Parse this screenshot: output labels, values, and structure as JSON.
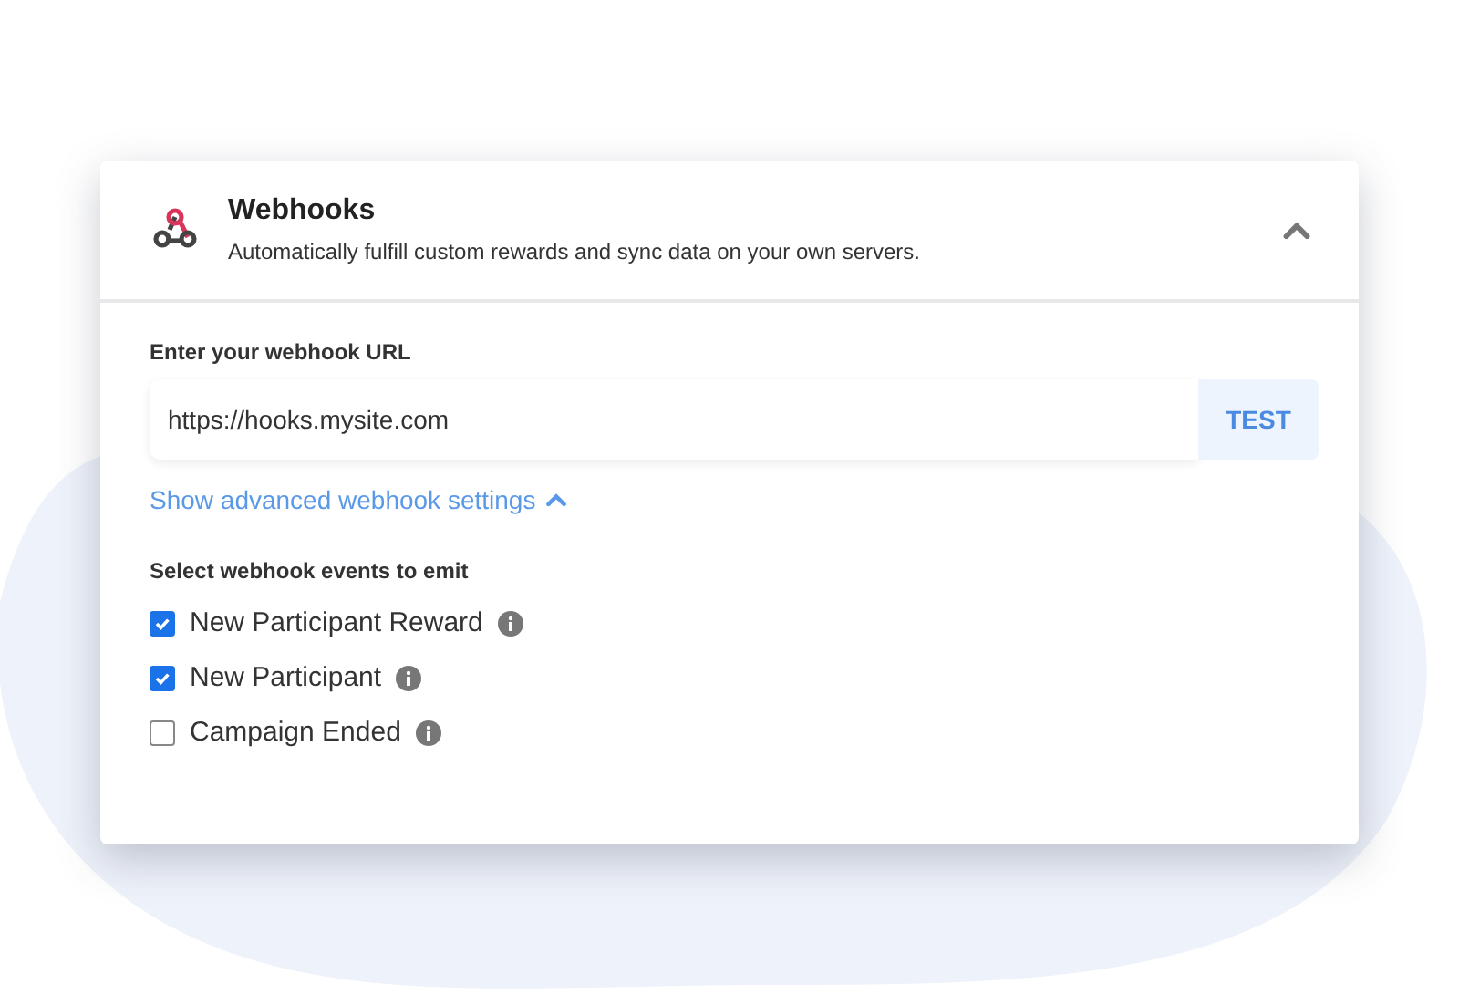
{
  "panel": {
    "title": "Webhooks",
    "description": "Automatically fulfill custom rewards and sync data on your own servers.",
    "expanded": true
  },
  "url_field": {
    "label": "Enter your webhook URL",
    "value": "https://hooks.mysite.com",
    "button": "TEST"
  },
  "advanced": {
    "label": "Show advanced webhook settings",
    "expanded": true
  },
  "events": {
    "label": "Select webhook events to emit",
    "items": [
      {
        "label": "New Participant Reward",
        "checked": true
      },
      {
        "label": "New Participant",
        "checked": true
      },
      {
        "label": "Campaign Ended",
        "checked": false
      }
    ]
  }
}
